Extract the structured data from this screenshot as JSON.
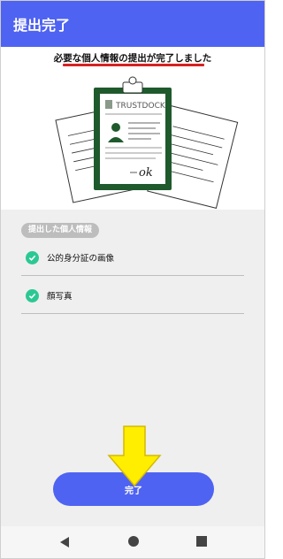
{
  "header": {
    "title": "提出完了"
  },
  "headline": "必要な個人情報の提出が完了しました",
  "illustration": {
    "brand": "TRUSTDOCK",
    "signature": "ok"
  },
  "section": {
    "badge": "提出した個人情報",
    "items": [
      {
        "label": "公的身分証の画像"
      },
      {
        "label": "顔写真"
      }
    ]
  },
  "done_button": {
    "label": "完了"
  },
  "colors": {
    "primary": "#4f63f2",
    "check": "#2cc893",
    "underline": "#d42323",
    "arrow": "#ffee00",
    "clipboard": "#1f5a2d"
  },
  "navbar": {
    "icons": [
      "back-icon",
      "home-icon",
      "recents-icon"
    ]
  }
}
